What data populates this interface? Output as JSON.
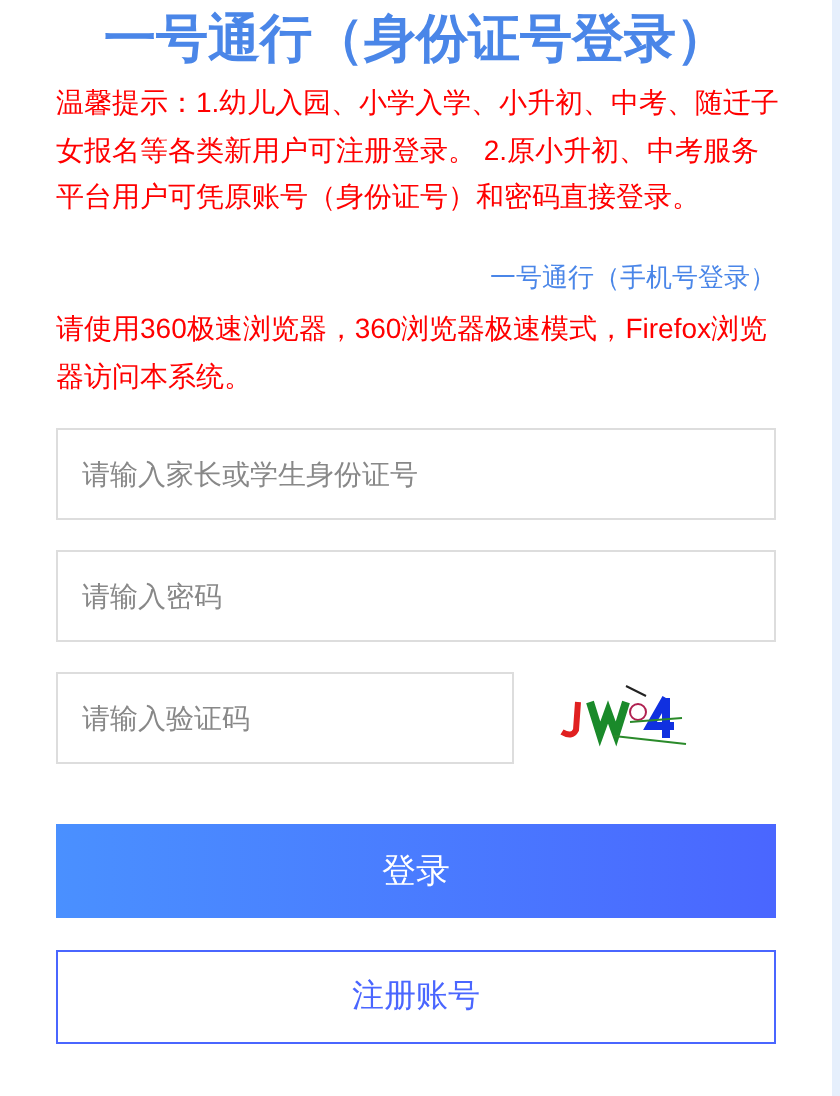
{
  "title": "一号通行（身份证号登录）",
  "notice": "温馨提示：1.幼儿入园、小学入学、小升初、中考、随迁子女报名等各类新用户可注册登录。 2.原小升初、中考服务平台用户可凭原账号（身份证号）和密码直接登录。",
  "alt_login_link": "一号通行（手机号登录）",
  "browser_notice": "请使用360极速浏览器，360浏览器极速模式，Firefox浏览器访问本系统。",
  "fields": [
    {
      "placeholder": "请输入家长或学生身份证号"
    },
    {
      "placeholder": "请输入密码"
    }
  ],
  "captcha": {
    "placeholder": "请输入验证码",
    "kind": "picture"
  },
  "login_button": "登录",
  "register_button": "注册账号"
}
